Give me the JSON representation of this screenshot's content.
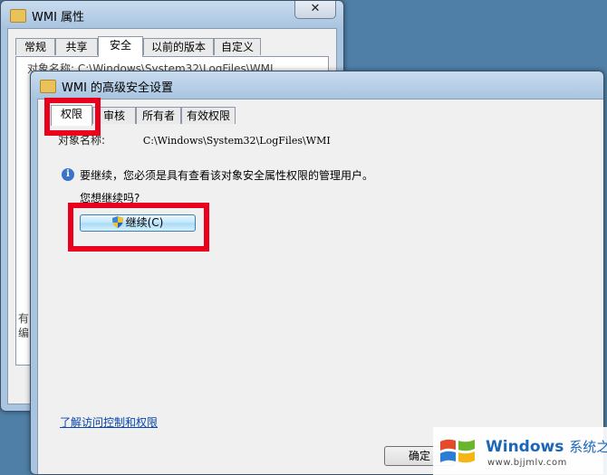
{
  "back_window": {
    "title": "WMI 属性",
    "close_glyph": "✕",
    "tabs": [
      "常规",
      "共享",
      "安全",
      "以前的版本",
      "自定义"
    ],
    "active_tab": 2,
    "object_fragment": "对象名称:   C:\\Windows\\System32\\LogFiles\\WMI",
    "side_fragments": [
      "有",
      "编",
      " "
    ]
  },
  "front_window": {
    "title": "WMI 的高级安全设置",
    "tabs": [
      "权限",
      "审核",
      "所有者",
      "有效权限"
    ],
    "active_tab": 0,
    "object_label": "对象名称:",
    "object_path": "C:\\Windows\\System32\\LogFiles\\WMI",
    "info_glyph": "i",
    "info_text": "要继续，您必须是具有查看该对象安全属性权限的管理用户。",
    "ask_text": "您想继续吗?",
    "continue_label": "继续(C)",
    "link_text": "了解访问控制和权限",
    "ok_label": "确定"
  },
  "highlight_color": "#e8001c",
  "watermark": {
    "brand": "Windows",
    "brand_suffix": "系统之家",
    "url": "www.bjjmlv.com"
  }
}
